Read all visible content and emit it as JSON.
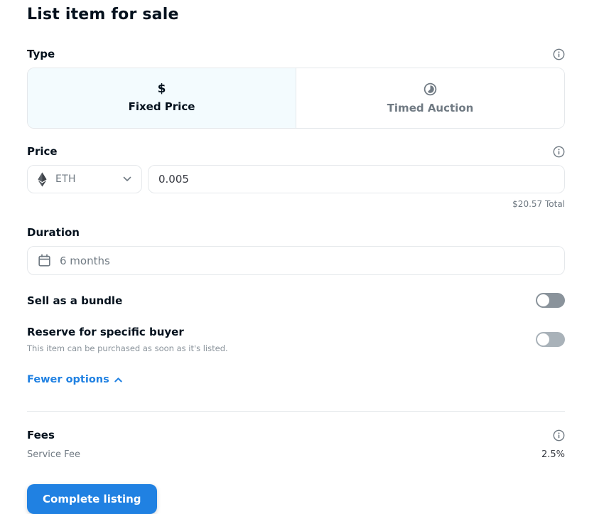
{
  "page": {
    "title": "List item for sale"
  },
  "type_section": {
    "label": "Type",
    "options": [
      {
        "label": "Fixed Price",
        "icon": "dollar-icon",
        "selected": true
      },
      {
        "label": "Timed Auction",
        "icon": "timelapse-icon",
        "selected": false
      }
    ]
  },
  "price_section": {
    "label": "Price",
    "currency": "ETH",
    "amount": "0.005",
    "total": "$20.57 Total"
  },
  "duration_section": {
    "label": "Duration",
    "value": "6 months"
  },
  "toggles": {
    "bundle": {
      "label": "Sell as a bundle",
      "state": "off"
    },
    "reserve": {
      "label": "Reserve for specific buyer",
      "description": "This item can be purchased as soon as it's listed.",
      "state": "off"
    }
  },
  "options_link": {
    "label": "Fewer options"
  },
  "fees_section": {
    "label": "Fees",
    "rows": [
      {
        "name": "Service Fee",
        "value": "2.5%"
      }
    ]
  },
  "submit": {
    "label": "Complete listing"
  },
  "colors": {
    "accent": "#2081e2",
    "selected_bg": "#f3fbfe",
    "border": "#e5e8eb",
    "text_dark": "#04111d",
    "text_gray": "#707a83"
  }
}
